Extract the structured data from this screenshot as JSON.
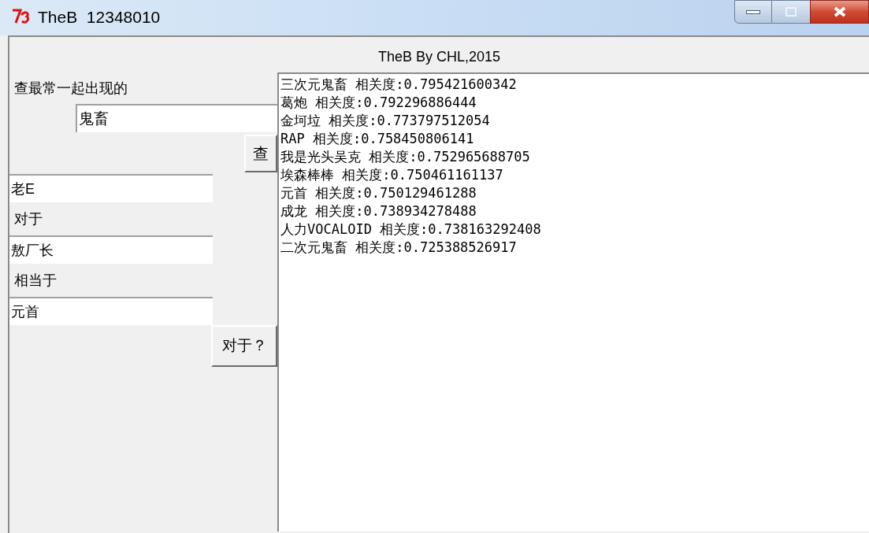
{
  "window": {
    "title": "TheB  12348010"
  },
  "header": "TheB By CHL,2015",
  "search": {
    "label": "查最常一起出现的",
    "value": "鬼畜",
    "button": "查"
  },
  "analogy": {
    "word_a": "老E",
    "relation_1": "对于",
    "word_b": "敖厂长",
    "relation_2": "相当于",
    "word_c": "元首",
    "button": "对于？"
  },
  "results": [
    "三次元鬼畜 相关度:0.795421600342",
    "葛炮 相关度:0.792296886444",
    "金坷垃 相关度:0.773797512054",
    "RAP 相关度:0.758450806141",
    "我是光头吴克 相关度:0.752965688705",
    "埃森棒棒 相关度:0.750461161137",
    "元首 相关度:0.750129461288",
    "成龙 相关度:0.738934278488",
    "人力VOCALOID 相关度:0.738163292408",
    "二次元鬼畜 相关度:0.725388526917"
  ]
}
